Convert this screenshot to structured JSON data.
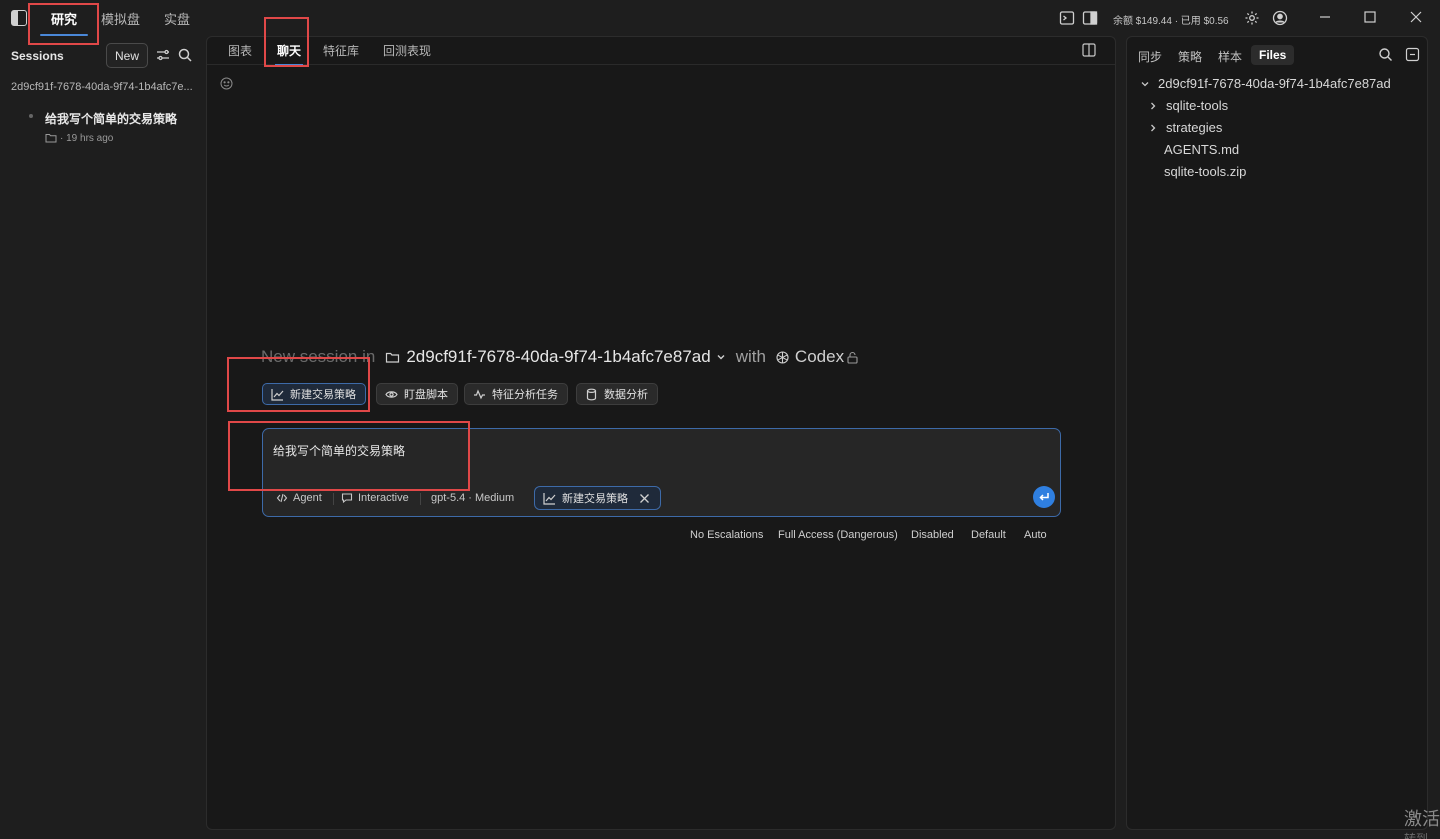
{
  "titlebar": {
    "tabs": [
      "研究",
      "模拟盘",
      "实盘"
    ],
    "active_tab": "研究",
    "balance": "余额 $149.44 · 已用 $0.56"
  },
  "left_panel": {
    "sessions_label": "Sessions",
    "new_label": "New",
    "workspace": "2d9cf91f-7678-40da-9f74-1b4afc7e...",
    "session": {
      "title": "给我写个简单的交易策略",
      "meta": "· 19 hrs ago"
    }
  },
  "center": {
    "tabs": [
      "图表",
      "聊天",
      "特征库",
      "回测表现"
    ],
    "active_tab": "聊天",
    "new_session": {
      "prefix": "New session in",
      "path": "2d9cf91f-7678-40da-9f74-1b4afc7e87ad",
      "with": "with",
      "agent": "Codex"
    },
    "chips": [
      "新建交易策略",
      "盯盘脚本",
      "特征分析任务",
      "数据分析"
    ],
    "composer": {
      "text": "给我写个简单的交易策略",
      "mode": "Agent",
      "interaction": "Interactive",
      "model": "gpt-5.4 · Medium",
      "attached_chip": "新建交易策略"
    },
    "modes": [
      "No Escalations",
      "Full Access (Dangerous)",
      "Disabled",
      "Default",
      "Auto"
    ]
  },
  "right_panel": {
    "tabs": [
      "同步",
      "策略",
      "样本",
      "Files"
    ],
    "active_tab": "Files",
    "tree": {
      "root": "2d9cf91f-7678-40da-9f74-1b4afc7e87ad",
      "folders": [
        "sqlite-tools",
        "strategies"
      ],
      "files": [
        "AGENTS.md",
        "sqlite-tools.zip"
      ]
    }
  },
  "watermark": {
    "line1": "激活",
    "line2": "转到"
  },
  "colors": {
    "accent": "#4a88d8",
    "highlight": "#e04848",
    "send": "#2f7fe0"
  }
}
